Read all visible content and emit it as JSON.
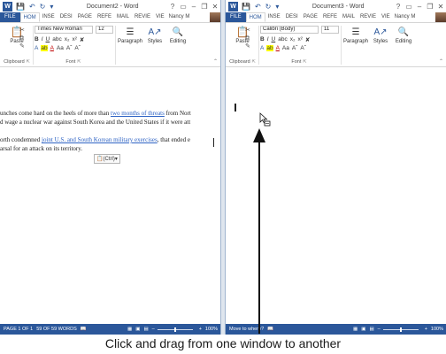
{
  "left_window": {
    "logo": "W",
    "title": "Document2 - Word",
    "help": "?",
    "window_controls": [
      "▭",
      "–",
      "❐",
      "✕"
    ],
    "tabs": [
      "FILE",
      "HOM",
      "INSE",
      "DESI",
      "PAGE",
      "REFE",
      "MAIL",
      "REVIE",
      "VIE"
    ],
    "active_tab": "HOM",
    "user": "Nancy M",
    "font_name": "Times New Roman",
    "font_size": "12",
    "groups": {
      "clipboard": "Clipboard",
      "font": "Font",
      "paragraph": "Paragraph",
      "styles": "Styles",
      "editing": "Editing"
    },
    "paste_label": "Paste",
    "doc_lines": {
      "l1_pre": "unches come hard on the heels of more than ",
      "l1_link": "two months of threats",
      "l1_post": " from Nort",
      "l2": "d wage a nuclear war against South Korea and the United States if it were att",
      "l3_pre": "orth condemned ",
      "l3_link": "joint U.S. and South Korean military exercises",
      "l3_post": ", that ended e",
      "l4": "arsal for an attack on its territory."
    },
    "paste_options": "(Ctrl)",
    "status": {
      "page": "PAGE 1 OF 1",
      "words": "59 OF 59 WORDS",
      "zoom": "100%"
    }
  },
  "right_window": {
    "logo": "W",
    "title": "Document3 - Word",
    "help": "?",
    "window_controls": [
      "▭",
      "–",
      "❐",
      "✕"
    ],
    "tabs": [
      "FILE",
      "HOM",
      "INSE",
      "DESI",
      "PAGE",
      "REFE",
      "MAIL",
      "REVIE",
      "VIE"
    ],
    "active_tab": "HOM",
    "user": "Nancy M",
    "font_name": "Calibri (Body)",
    "font_size": "11",
    "groups": {
      "clipboard": "Clipboard",
      "font": "Font",
      "paragraph": "Paragraph",
      "styles": "Styles",
      "editing": "Editing"
    },
    "paste_label": "Paste",
    "status": {
      "message": "Move to where?",
      "zoom": "100%"
    }
  },
  "caption": "Click and drag from one window to another",
  "colors": {
    "word_blue": "#2b579a",
    "link": "#2e63c4"
  }
}
